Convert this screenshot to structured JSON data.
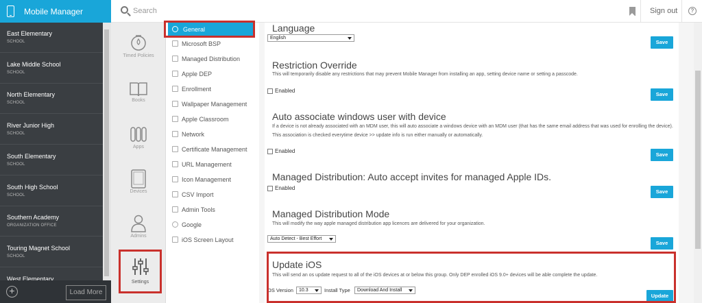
{
  "app": {
    "title": "Mobile Manager"
  },
  "header": {
    "search_placeholder": "Search",
    "signout_label": "Sign out",
    "help_glyph": "?"
  },
  "schools": [
    {
      "name": "East Elementary",
      "type": "SCHOOL"
    },
    {
      "name": "Lake Middle School",
      "type": "SCHOOL"
    },
    {
      "name": "North Elementary",
      "type": "SCHOOL"
    },
    {
      "name": "River Junior High",
      "type": "SCHOOL"
    },
    {
      "name": "South Elementary",
      "type": "SCHOOL"
    },
    {
      "name": "South High School",
      "type": "SCHOOL"
    },
    {
      "name": "Southern Academy",
      "type": "ORGANIZATION OFFICE"
    },
    {
      "name": "Touring Magnet School",
      "type": "SCHOOL"
    },
    {
      "name": "West Elementary",
      "type": ""
    }
  ],
  "school_footer": {
    "add_glyph": "+",
    "load_more_label": "Load More"
  },
  "rail": [
    {
      "label": "Timed Policies",
      "icon": "timer-icon"
    },
    {
      "label": "Books",
      "icon": "book-icon"
    },
    {
      "label": "Apps",
      "icon": "apps-icon"
    },
    {
      "label": "Devices",
      "icon": "tablet-icon"
    },
    {
      "label": "Admins",
      "icon": "person-icon"
    },
    {
      "label": "Settings",
      "icon": "sliders-icon"
    }
  ],
  "menu": [
    {
      "label": "General",
      "active": true
    },
    {
      "label": "Microsoft BSP"
    },
    {
      "label": "Managed Distribution"
    },
    {
      "label": "Apple DEP"
    },
    {
      "label": "Enrollment"
    },
    {
      "label": "Wallpaper Management"
    },
    {
      "label": "Apple Classroom"
    },
    {
      "label": "Network"
    },
    {
      "label": "Certificate Management"
    },
    {
      "label": "URL Management"
    },
    {
      "label": "Icon Management"
    },
    {
      "label": "CSV Import"
    },
    {
      "label": "Admin Tools"
    },
    {
      "label": "Google"
    },
    {
      "label": "iOS Screen Layout"
    }
  ],
  "sections": {
    "language": {
      "title": "Language",
      "value": "English",
      "save": "Save"
    },
    "restriction": {
      "title": "Restriction Override",
      "desc": "This will temporarily disable any restrictions that may prevent Mobile Manager from installing an app, setting device name or setting a passcode.",
      "checkbox": "Enabled",
      "save": "Save"
    },
    "auto_assoc": {
      "title": "Auto associate windows user with device",
      "desc": "If a device is not already associated with an MDM user, this will auto associate a windows device with an MDM user (that has the same email address that was used for enrolling the device). This association is checked everytime device >> update info is run either manually or automatically.",
      "checkbox": "Enabled",
      "save": "Save"
    },
    "md_invites": {
      "title": "Managed Distribution: Auto accept invites for managed Apple IDs.",
      "checkbox": "Enabled",
      "save": "Save"
    },
    "md_mode": {
      "title": "Managed Distribution Mode",
      "desc": "This will modify the way apple managed distribution app licences are delivered for your organization.",
      "value": "Auto Detect - Best Effort",
      "save": "Save"
    },
    "update_ios": {
      "title": "Update iOS",
      "desc": "This will send an os update request to all of the iOS devices at or below this group. Only DEP enrolled iOS 9.0+ devices will be able complete the update.",
      "os_label": "OS Version",
      "os_value": "10.3",
      "install_label": "Install Type",
      "install_value": "Download And Install",
      "update": "Update"
    }
  },
  "colors": {
    "accent": "#19a6d9",
    "sidebar": "#3a3e42",
    "highlight": "#c9302c"
  }
}
